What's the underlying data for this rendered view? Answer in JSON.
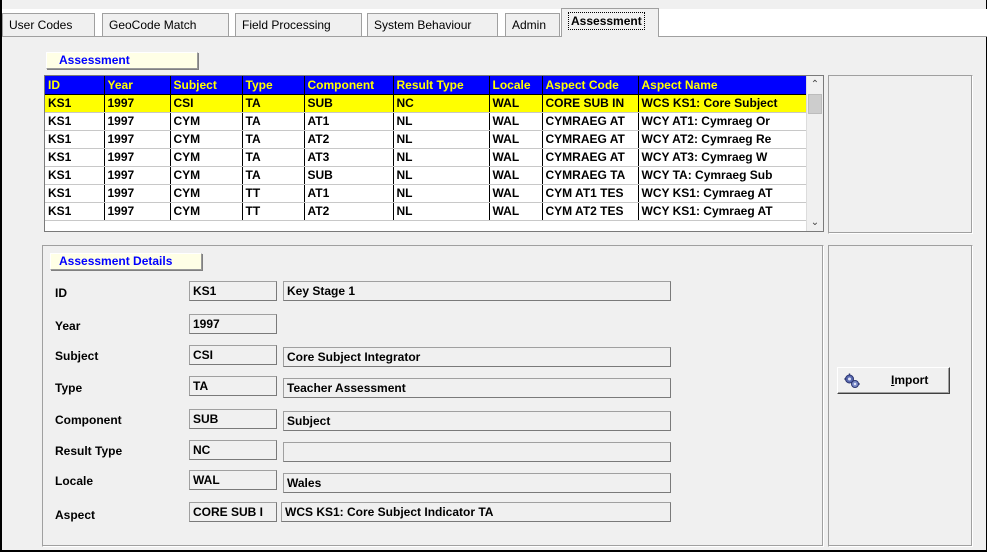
{
  "tabs": [
    {
      "label": "User Codes"
    },
    {
      "label": "GeoCode Match"
    },
    {
      "label": "Field Processing"
    },
    {
      "label": "System Behaviour"
    },
    {
      "label": "Admin"
    },
    {
      "label": "Assessment"
    }
  ],
  "assessment_caption": "Assessment",
  "grid": {
    "columns": [
      "ID",
      "Year",
      "Subject",
      "Type",
      "Component",
      "Result Type",
      "Locale",
      "Aspect Code",
      "Aspect Name"
    ],
    "rows": [
      [
        "KS1",
        "1997",
        "CSI",
        "TA",
        "SUB",
        "NC",
        "WAL",
        "CORE SUB IN",
        "WCS KS1: Core Subject"
      ],
      [
        "KS1",
        "1997",
        "CYM",
        "TA",
        "AT1",
        "NL",
        "WAL",
        "CYMRAEG AT",
        "WCY AT1: Cymraeg Or"
      ],
      [
        "KS1",
        "1997",
        "CYM",
        "TA",
        "AT2",
        "NL",
        "WAL",
        "CYMRAEG AT",
        "WCY AT2: Cymraeg Re"
      ],
      [
        "KS1",
        "1997",
        "CYM",
        "TA",
        "AT3",
        "NL",
        "WAL",
        "CYMRAEG AT",
        "WCY AT3: Cymraeg W"
      ],
      [
        "KS1",
        "1997",
        "CYM",
        "TA",
        "SUB",
        "NL",
        "WAL",
        "CYMRAEG TA",
        "WCY TA: Cymraeg Sub"
      ],
      [
        "KS1",
        "1997",
        "CYM",
        "TT",
        "AT1",
        "NL",
        "WAL",
        "CYM AT1 TES",
        "WCY KS1: Cymraeg AT"
      ],
      [
        "KS1",
        "1997",
        "CYM",
        "TT",
        "AT2",
        "NL",
        "WAL",
        "CYM AT2 TES",
        "WCY KS1: Cymraeg AT"
      ]
    ],
    "selected_row_index": 0
  },
  "details": {
    "caption": "Assessment Details",
    "id": {
      "label": "ID",
      "code": "KS1",
      "desc": "Key Stage 1"
    },
    "year": {
      "label": "Year",
      "code": "1997"
    },
    "subject": {
      "label": "Subject",
      "code": "CSI",
      "desc": "Core Subject Integrator"
    },
    "type": {
      "label": "Type",
      "code": "TA",
      "desc": "Teacher Assessment"
    },
    "component": {
      "label": "Component",
      "code": "SUB",
      "desc": "Subject"
    },
    "result_type": {
      "label": "Result Type",
      "code": "NC",
      "desc": ""
    },
    "locale": {
      "label": "Locale",
      "code": "WAL",
      "desc": "Wales"
    },
    "aspect": {
      "label": "Aspect",
      "code": "CORE SUB I",
      "desc": "WCS KS1: Core Subject Indicator TA"
    }
  },
  "import_button": {
    "label_first": "I",
    "label_rest": "mport",
    "icon": "gears-icon"
  },
  "colors": {
    "header_bg": "#0000ff",
    "header_fg": "#ffff00",
    "selected_row": "#ffff00",
    "caption_text": "#0000ff"
  }
}
